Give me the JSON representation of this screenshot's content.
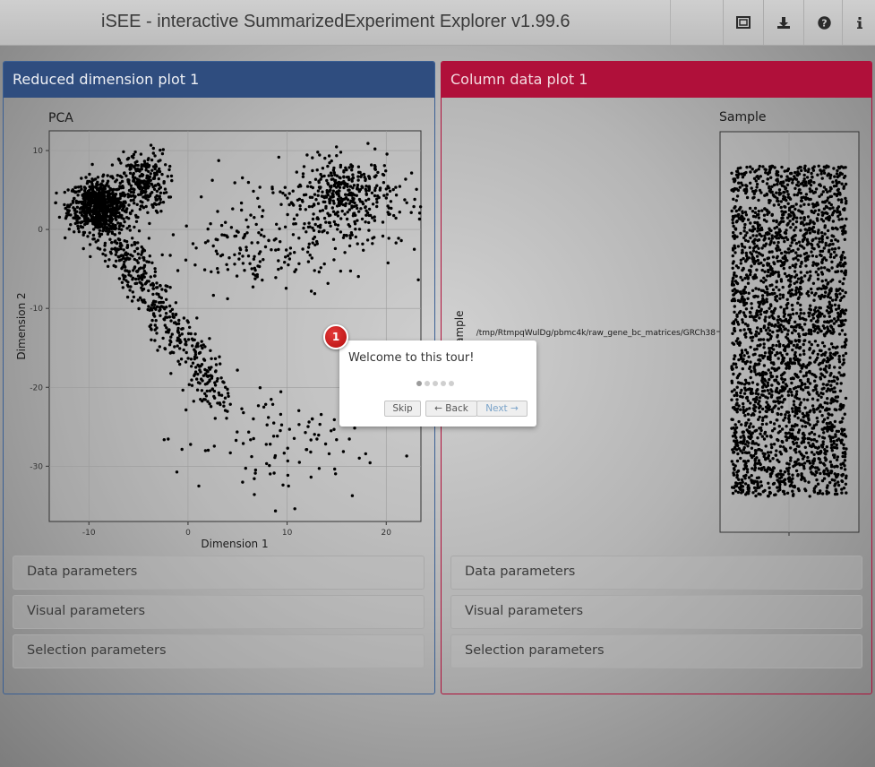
{
  "app": {
    "title": "iSEE - interactive SummarizedExperiment Explorer v1.99.6",
    "toolbar": [
      {
        "icon": "screenshot-icon",
        "glyph": "⊡"
      },
      {
        "icon": "download-icon",
        "glyph": "⬇"
      },
      {
        "icon": "help-icon",
        "glyph": "?"
      },
      {
        "icon": "info-icon",
        "glyph": "i"
      }
    ]
  },
  "panels": {
    "left": {
      "title": "Reduced dimension plot 1",
      "color": "#2f4d7f",
      "sections": [
        "Data parameters",
        "Visual parameters",
        "Selection parameters"
      ]
    },
    "right": {
      "title": "Column data plot 1",
      "color": "#b0103a",
      "sections": [
        "Data parameters",
        "Visual parameters",
        "Selection parameters"
      ]
    }
  },
  "tour": {
    "message": "Welcome to this tour!",
    "step": 1,
    "total_steps": 5,
    "buttons": {
      "skip": "Skip",
      "back": "← Back",
      "next": "Next →"
    }
  },
  "chart_data": [
    {
      "type": "scatter",
      "title": "PCA",
      "xlabel": "Dimension 1",
      "ylabel": "Dimension 2",
      "xlim": [
        -14,
        23.5
      ],
      "ylim": [
        -37,
        12.5
      ],
      "xticks": [
        -10,
        0,
        10,
        20
      ],
      "yticks": [
        -30,
        -20,
        -10,
        0,
        10
      ],
      "grid": true,
      "note": "approximately 2700 cells, black points",
      "clusters": [
        {
          "name": "",
          "center": [
            -9,
            3
          ],
          "spread": [
            1.5,
            1.6
          ],
          "n": 700
        },
        {
          "name": "",
          "center": [
            -4.5,
            6
          ],
          "spread": [
            1.2,
            2.0
          ],
          "n": 250
        },
        {
          "name": "",
          "center": [
            16,
            4.5
          ],
          "spread": [
            2.5,
            2.2
          ],
          "n": 350
        },
        {
          "name": "",
          "center": [
            12,
            0
          ],
          "spread": [
            6,
            3.5
          ],
          "n": 180
        },
        {
          "name": "",
          "trail_from": [
            -9,
            2
          ],
          "trail_to": [
            3,
            -21
          ],
          "n": 500
        },
        {
          "name": "",
          "center": [
            8,
            -27
          ],
          "spread": [
            5,
            4
          ],
          "n": 110
        },
        {
          "name": "",
          "center": [
            5,
            -3
          ],
          "spread": [
            3,
            2.5
          ],
          "n": 70
        }
      ]
    },
    {
      "type": "scatter",
      "title": "Sample",
      "xlabel": "",
      "ylabel": "Sample",
      "categories": [
        "/tmp/RtmpqWulDg/pbmc4k/raw_gene_bc_matrices/GRCh38"
      ],
      "note": "jittered violin of points for a single category",
      "n": 2700
    }
  ]
}
